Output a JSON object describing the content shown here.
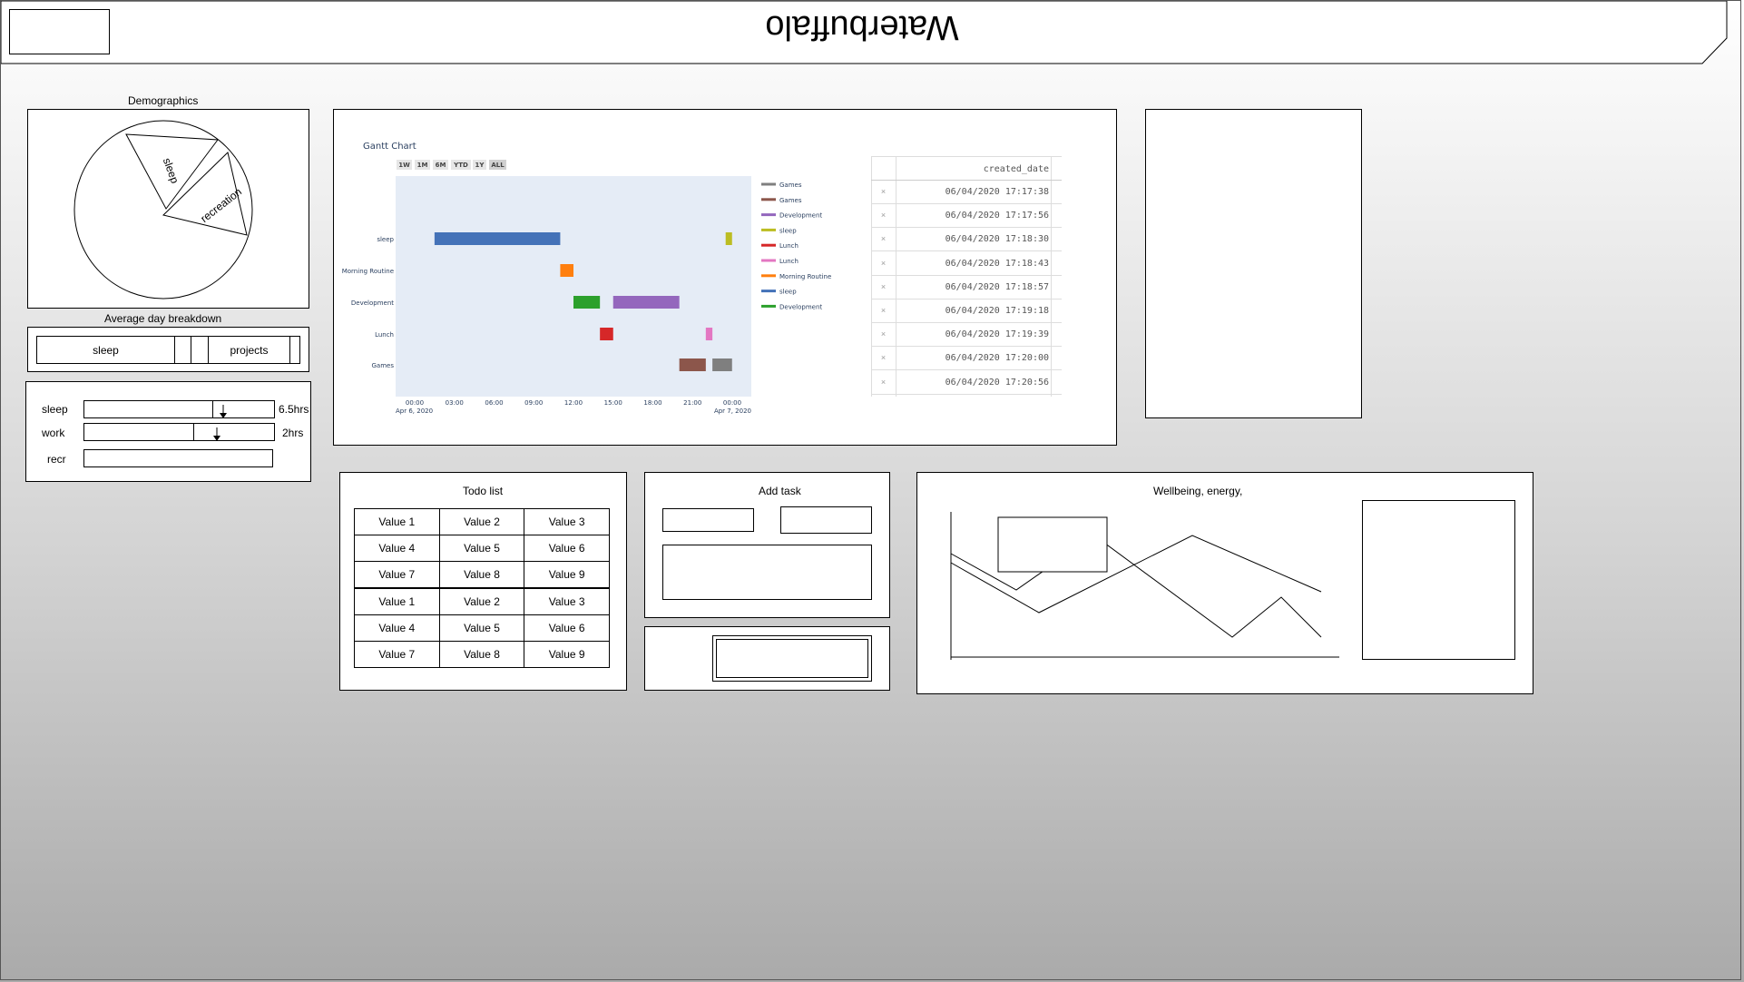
{
  "header": {
    "title": "Waterbuffalo"
  },
  "demographics": {
    "title": "Demographics",
    "slices": [
      "sleep",
      "recreation"
    ]
  },
  "breakdown": {
    "title": "Average day breakdown",
    "segments": [
      "sleep",
      "",
      "",
      "projects",
      ""
    ]
  },
  "sliders": [
    {
      "label": "sleep",
      "value_text": "6.5hrs",
      "level": 0.75
    },
    {
      "label": "work",
      "value_text": "2hrs",
      "level": 0.7
    },
    {
      "label": "recr",
      "value_text": "",
      "level": null
    }
  ],
  "gantt": {
    "title": "Gantt Chart",
    "range_buttons": [
      "1W",
      "1M",
      "6M",
      "YTD",
      "1Y",
      "ALL"
    ],
    "active_range": "ALL",
    "y_labels": [
      "sleep",
      "Morning Routine",
      "Development",
      "Lunch",
      "Games"
    ],
    "x_tick_labels": [
      "00:00",
      "03:00",
      "06:00",
      "09:00",
      "12:00",
      "15:00",
      "18:00",
      "21:00",
      "00:00"
    ],
    "x_start_date": "Apr 6, 2020",
    "x_end_date": "Apr 7, 2020"
  },
  "chart_data": {
    "type": "bar",
    "title": "Gantt Chart",
    "xlabel": "",
    "ylabel": "",
    "x_range": [
      "2020-04-06 00:00",
      "2020-04-07 00:00"
    ],
    "categories": [
      "sleep",
      "Morning Routine",
      "Development",
      "Lunch",
      "Games"
    ],
    "legend_position": "right",
    "tasks": [
      {
        "task": "sleep",
        "start": "2020-04-06 01:30",
        "end": "2020-04-06 11:00",
        "color": "#4472b8"
      },
      {
        "task": "sleep",
        "start": "2020-04-06 23:30",
        "end": "2020-04-06 23:59",
        "color": "#bcbd22"
      },
      {
        "task": "Morning Routine",
        "start": "2020-04-06 11:00",
        "end": "2020-04-06 12:00",
        "color": "#ff7f0e"
      },
      {
        "task": "Development",
        "start": "2020-04-06 12:00",
        "end": "2020-04-06 14:00",
        "color": "#2ca02c"
      },
      {
        "task": "Development",
        "start": "2020-04-06 15:00",
        "end": "2020-04-06 20:00",
        "color": "#9467bd"
      },
      {
        "task": "Lunch",
        "start": "2020-04-06 14:00",
        "end": "2020-04-06 15:00",
        "color": "#d62728"
      },
      {
        "task": "Lunch",
        "start": "2020-04-06 22:00",
        "end": "2020-04-06 22:30",
        "color": "#e377c2"
      },
      {
        "task": "Games",
        "start": "2020-04-06 20:00",
        "end": "2020-04-06 22:00",
        "color": "#8c564b"
      },
      {
        "task": "Games",
        "start": "2020-04-06 22:30",
        "end": "2020-04-06 23:59",
        "color": "#7f7f7f"
      }
    ],
    "legend": [
      {
        "name": "Games",
        "color": "#7f7f7f"
      },
      {
        "name": "Games",
        "color": "#8c564b"
      },
      {
        "name": "Development",
        "color": "#9467bd"
      },
      {
        "name": "sleep",
        "color": "#bcbd22"
      },
      {
        "name": "Lunch",
        "color": "#d62728"
      },
      {
        "name": "Lunch",
        "color": "#e377c2"
      },
      {
        "name": "Morning Routine",
        "color": "#ff7f0e"
      },
      {
        "name": "sleep",
        "color": "#4472b8"
      },
      {
        "name": "Development",
        "color": "#2ca02c"
      }
    ]
  },
  "created_table": {
    "header": "created_date",
    "rows": [
      "06/04/2020 17:17:38",
      "06/04/2020 17:17:56",
      "06/04/2020 17:18:30",
      "06/04/2020 17:18:43",
      "06/04/2020 17:18:57",
      "06/04/2020 17:19:18",
      "06/04/2020 17:19:39",
      "06/04/2020 17:20:00",
      "06/04/2020 17:20:56"
    ],
    "delete_glyph": "×"
  },
  "todo": {
    "title": "Todo list",
    "rows": [
      [
        "Value 1",
        "Value 2",
        "Value 3"
      ],
      [
        "Value 4",
        "Value 5",
        "Value 6"
      ],
      [
        "Value 7",
        "Value 8",
        "Value 9"
      ],
      [
        "Value 1",
        "Value 2",
        "Value 3"
      ],
      [
        "Value 4",
        "Value 5",
        "Value 6"
      ],
      [
        "Value 7",
        "Value 8",
        "Value 9"
      ]
    ]
  },
  "add_task": {
    "title": "Add task"
  },
  "wellbeing": {
    "title": "Wellbeing, energy,"
  }
}
